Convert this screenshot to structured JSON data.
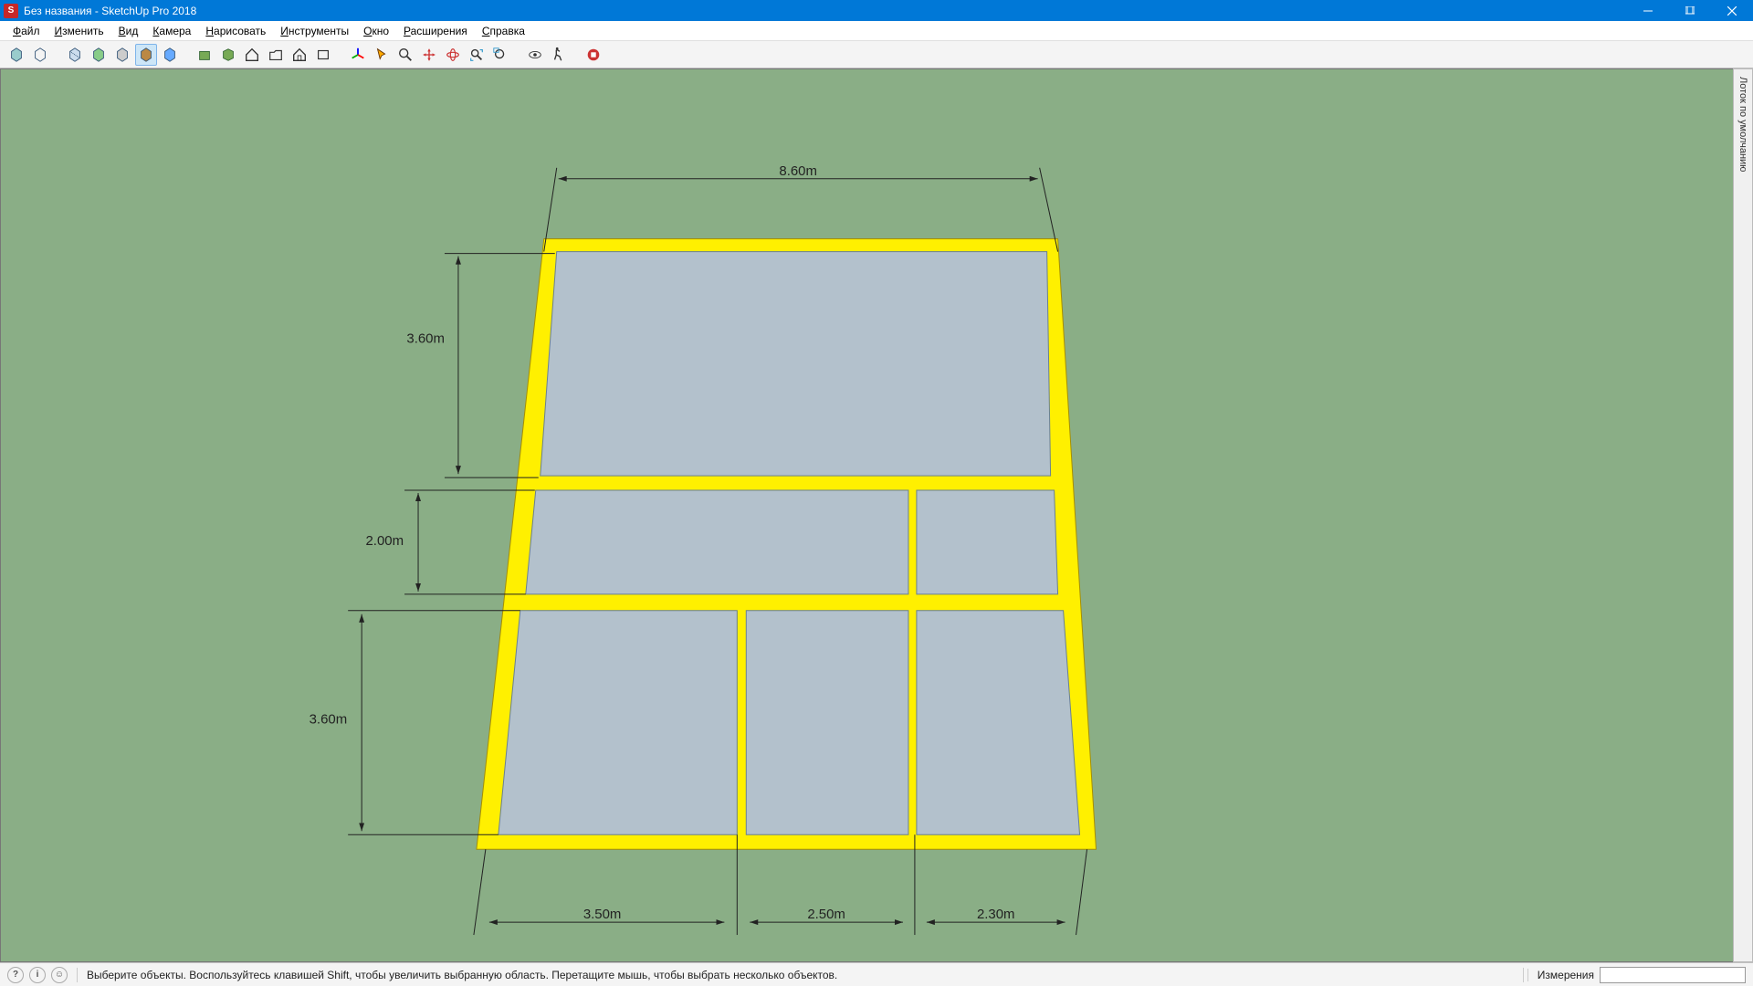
{
  "window_title": "Без названия - SketchUp Pro 2018",
  "menu": [
    "Файл",
    "Изменить",
    "Вид",
    "Камера",
    "Нарисовать",
    "Инструменты",
    "Окно",
    "Расширения",
    "Справка"
  ],
  "status_hint": "Выберите объекты. Воспользуйтесь клавишей Shift, чтобы увеличить выбранную область. Перетащите мышь, чтобы выбрать несколько объектов.",
  "measure_label": "Измерения",
  "side_panel_label": "Лоток по умолчанию",
  "dims": {
    "top": "8.60m",
    "left_top": "3.60m",
    "left_mid": "2.00m",
    "left_bot": "3.60m",
    "bot1": "3.50m",
    "bot2": "2.50m",
    "bot3": "2.30m"
  }
}
